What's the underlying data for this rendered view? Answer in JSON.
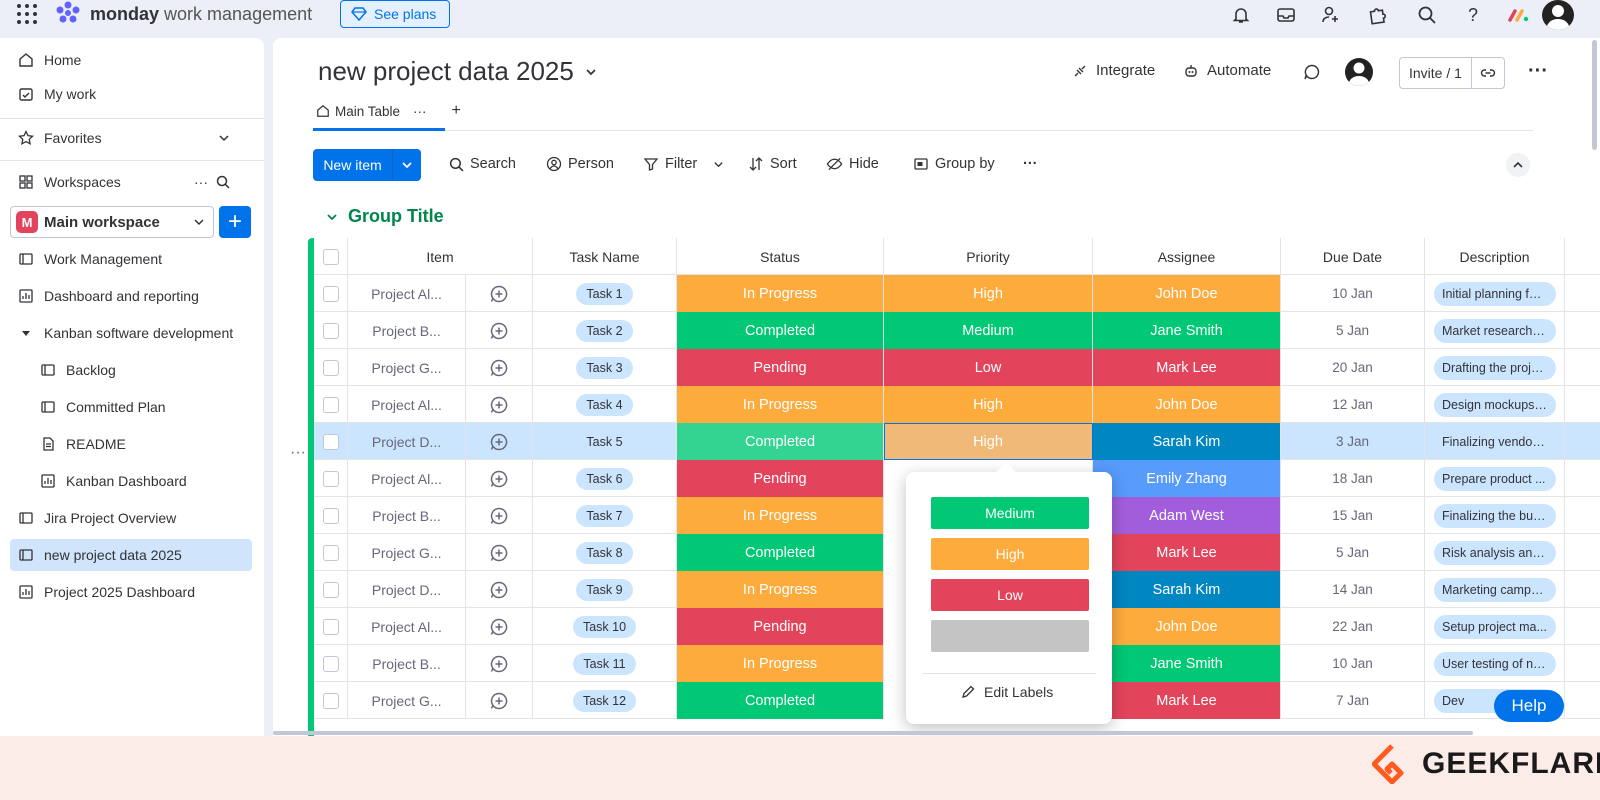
{
  "app": {
    "logo_bold": "monday",
    "logo_rest": "work management",
    "see_plans": "See plans"
  },
  "sidebar": {
    "home": "Home",
    "my_work": "My work",
    "favorites": "Favorites",
    "workspaces": "Workspaces",
    "workspace_name": "Main workspace",
    "workspace_badge": "M",
    "items": [
      {
        "label": "Work Management",
        "icon": "board-icon"
      },
      {
        "label": "Dashboard and reporting",
        "icon": "dashboard-icon"
      },
      {
        "label": "Kanban software development",
        "icon": "folder-caret-icon"
      },
      {
        "label": "Backlog",
        "icon": "board-icon"
      },
      {
        "label": "Committed Plan",
        "icon": "board-icon"
      },
      {
        "label": "README",
        "icon": "doc-icon"
      },
      {
        "label": "Kanban Dashboard",
        "icon": "dashboard-icon"
      },
      {
        "label": "Jira Project Overview",
        "icon": "board-icon"
      },
      {
        "label": "new project data 2025",
        "icon": "board-icon"
      },
      {
        "label": "Project 2025 Dashboard",
        "icon": "dashboard-icon"
      }
    ]
  },
  "board": {
    "title": "new project data 2025",
    "integrate": "Integrate",
    "automate": "Automate",
    "invite": "Invite / 1",
    "tab": "Main Table"
  },
  "toolbar": {
    "new_item": "New item",
    "search": "Search",
    "person": "Person",
    "filter": "Filter",
    "sort": "Sort",
    "hide": "Hide",
    "group_by": "Group by"
  },
  "group": {
    "title": "Group Title"
  },
  "table": {
    "headers": [
      "Item",
      "Task Name",
      "Status",
      "Priority",
      "Assignee",
      "Due Date",
      "Description"
    ],
    "rows": [
      {
        "item": "Project Al...",
        "task": "Task 1",
        "status": "In Progress",
        "priority": "High",
        "assignee": "John Doe",
        "due": "10 Jan",
        "desc": "Initial planning for..."
      },
      {
        "item": "Project B...",
        "task": "Task 2",
        "status": "Completed",
        "priority": "Medium",
        "assignee": "Jane Smith",
        "due": "5 Jan",
        "desc": "Market research a..."
      },
      {
        "item": "Project G...",
        "task": "Task 3",
        "status": "Pending",
        "priority": "Low",
        "assignee": "Mark Lee",
        "due": "20 Jan",
        "desc": "Drafting the proje..."
      },
      {
        "item": "Project Al...",
        "task": "Task 4",
        "status": "In Progress",
        "priority": "High",
        "assignee": "John Doe",
        "due": "12 Jan",
        "desc": "Design mockups ..."
      },
      {
        "item": "Project D...",
        "task": "Task 5",
        "status": "Completed",
        "priority": "High",
        "assignee": "Sarah Kim",
        "due": "3 Jan",
        "desc": "Finalizing vendor ..."
      },
      {
        "item": "Project Al...",
        "task": "Task 6",
        "status": "Pending",
        "priority": "",
        "assignee": "Emily Zhang",
        "due": "18 Jan",
        "desc": "Prepare product ..."
      },
      {
        "item": "Project B...",
        "task": "Task 7",
        "status": "In Progress",
        "priority": "",
        "assignee": "Adam West",
        "due": "15 Jan",
        "desc": "Finalizing the bud..."
      },
      {
        "item": "Project G...",
        "task": "Task 8",
        "status": "Completed",
        "priority": "",
        "assignee": "Mark Lee",
        "due": "5 Jan",
        "desc": "Risk analysis and ..."
      },
      {
        "item": "Project D...",
        "task": "Task 9",
        "status": "In Progress",
        "priority": "",
        "assignee": "Sarah Kim",
        "due": "14 Jan",
        "desc": "Marketing campai..."
      },
      {
        "item": "Project Al...",
        "task": "Task 10",
        "status": "Pending",
        "priority": "",
        "assignee": "John Doe",
        "due": "22 Jan",
        "desc": "Setup project ma..."
      },
      {
        "item": "Project B...",
        "task": "Task 11",
        "status": "In Progress",
        "priority": "",
        "assignee": "Jane Smith",
        "due": "10 Jan",
        "desc": "User testing of ne..."
      },
      {
        "item": "Project G...",
        "task": "Task 12",
        "status": "Completed",
        "priority": "",
        "assignee": "Mark Lee",
        "due": "7 Jan",
        "desc": "Dev"
      }
    ]
  },
  "colors": {
    "In Progress": "#fdab3d",
    "Completed": "#00c875",
    "Pending": "#e2445c",
    "High": "#fdab3d",
    "Medium": "#00c875",
    "Low": "#e2445c",
    "John Doe": "#fdab3d",
    "Jane Smith": "#00c875",
    "Mark Lee": "#e2445c",
    "Sarah Kim": "#0086c0",
    "Emily Zhang": "#579bfc",
    "Adam West": "#a25ddc"
  },
  "dropdown": {
    "options": [
      {
        "label": "Medium",
        "color": "#00c875"
      },
      {
        "label": "High",
        "color": "#fdab3d"
      },
      {
        "label": "Low",
        "color": "#e2445c"
      },
      {
        "label": "",
        "color": "#c4c4c4"
      }
    ],
    "edit_labels": "Edit Labels"
  },
  "help": "Help",
  "watermark": "GEEKFLARE"
}
